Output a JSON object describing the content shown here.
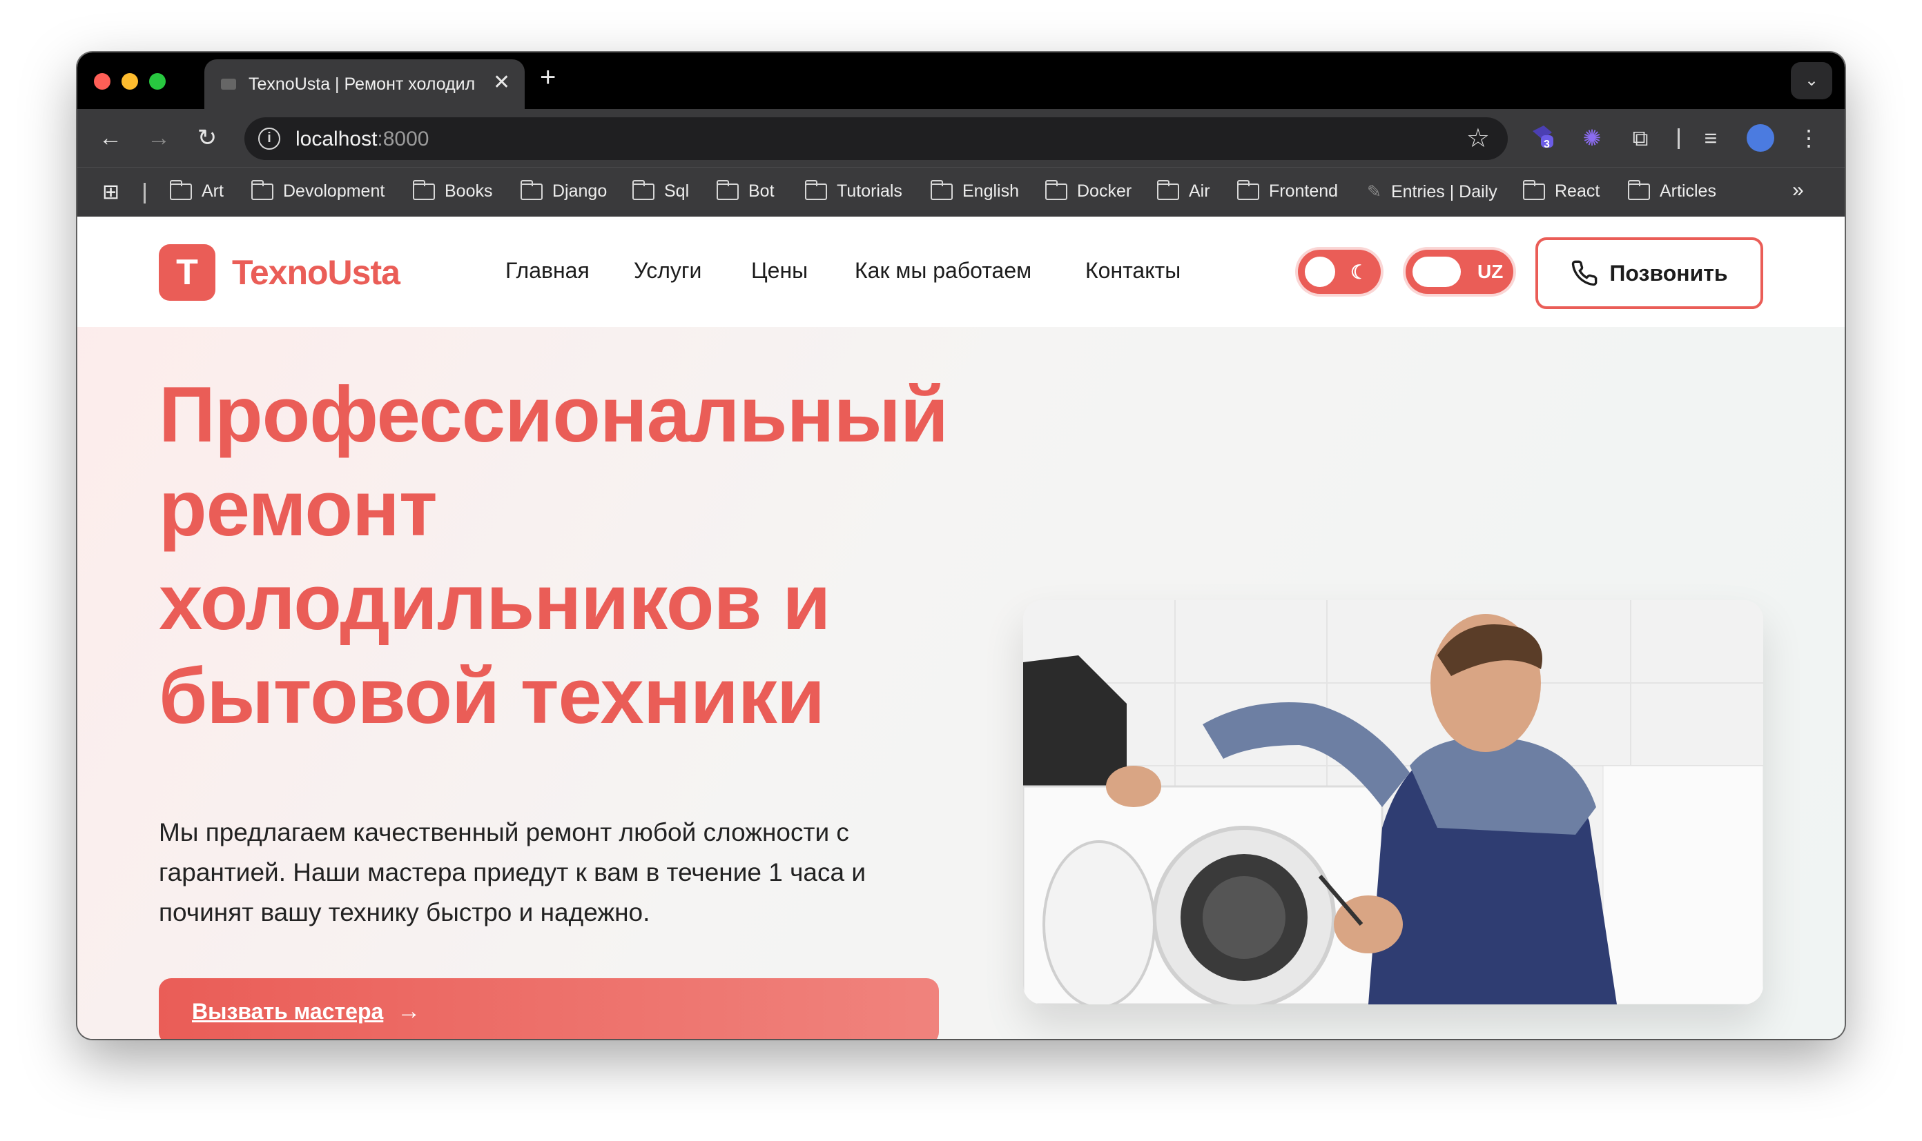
{
  "browser": {
    "tab_title": "TexnoUsta | Ремонт холодил",
    "url_host": "localhost",
    "url_port": ":8000",
    "extension_badge": "3",
    "bookmarks": [
      "Art",
      "Devolopment",
      "Books",
      "Django",
      "Sql",
      "Bot",
      "Tutorials",
      "English",
      "Docker",
      "Air",
      "Frontend",
      "Entries | Daily",
      "React",
      "Articles"
    ],
    "icons": {
      "back": "back-arrow-icon",
      "forward": "forward-arrow-icon",
      "reload": "reload-icon",
      "star": "star-icon",
      "extensions": "puzzle-icon",
      "menu": "kebab-menu-icon"
    },
    "colors": {
      "close": "#ff5f57",
      "minimize": "#febc2e",
      "maximize": "#28c840"
    }
  },
  "site": {
    "logo_letter": "T",
    "brand": "TexnoUsta",
    "nav": [
      "Главная",
      "Услуги",
      "Цены",
      "Как мы работаем",
      "Контакты"
    ],
    "lang_toggle": "UZ",
    "call_button": "Позвонить",
    "hero_title_lines": [
      "Профессиональный",
      "ремонт",
      "холодильников и",
      "бытовой техники"
    ],
    "hero_description": "Мы предлагаем качественный ремонт любой сложности с гарантией. Наши мастера приедут к вам в течение 1 часа и починят вашу технику быстро и надежно.",
    "cta_label": "Вызвать мастера",
    "accent_color": "#ea5d57",
    "hero_image": "repairman-with-washing-machine"
  }
}
